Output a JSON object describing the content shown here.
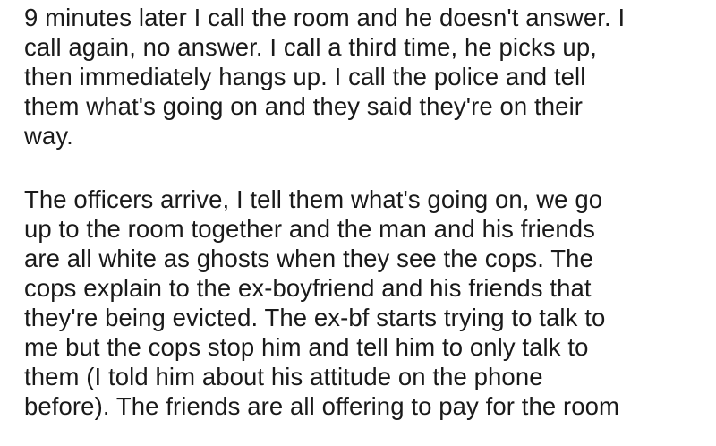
{
  "paragraphs": [
    {
      "lines": [
        "9 minutes later I call the room and he doesn't answer. I",
        "call again, no answer. I call a third time, he picks up,",
        "then immediately hangs up. I call the police and tell",
        "them what's going on and they said they're on their",
        "way."
      ]
    },
    {
      "lines": [
        "The officers arrive, I tell them what's going on, we go",
        "up to the room together and the man and his friends",
        "are all white as ghosts when they see the cops. The",
        "cops explain to the ex-boyfriend and his friends that",
        "they're being evicted. The ex-bf starts trying to talk to",
        "me but the cops stop him and tell him to only talk to",
        "them (I told him about his attitude on the phone",
        "before). The friends are all offering to pay for the room"
      ]
    }
  ]
}
